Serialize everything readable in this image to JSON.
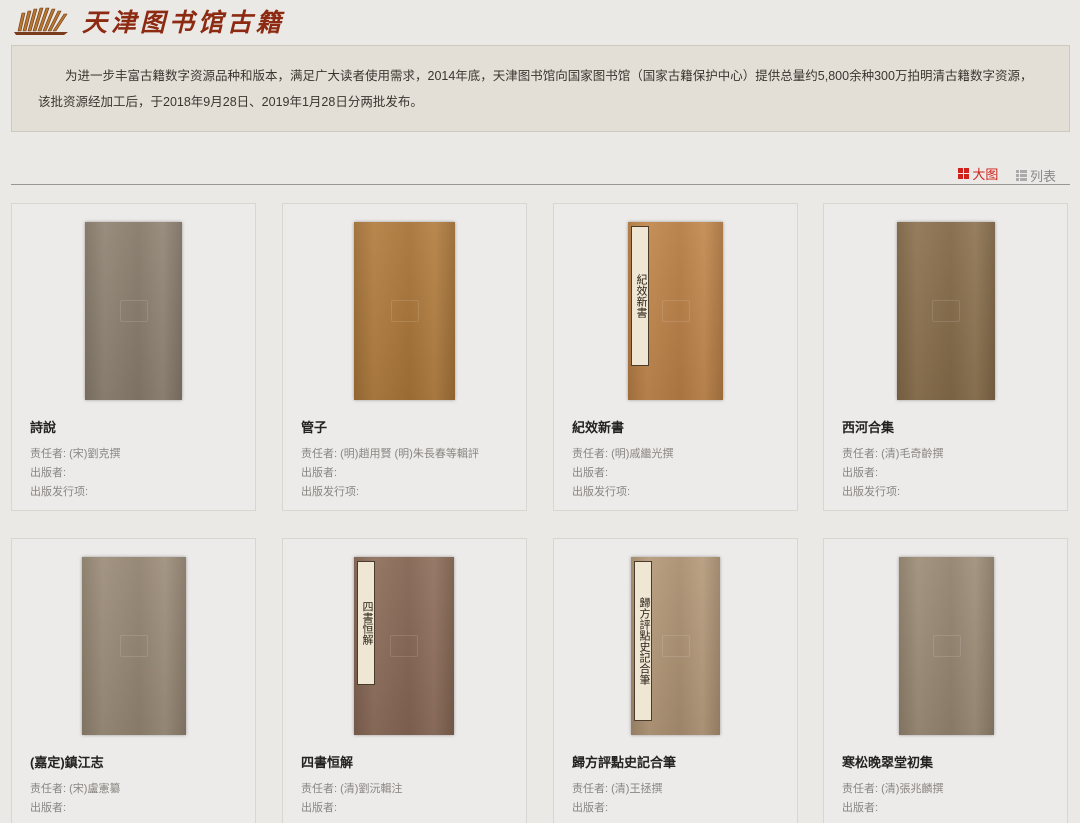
{
  "header": {
    "site_title": "天津图书馆古籍",
    "logo_icon": "bamboo-slips-icon"
  },
  "intro": {
    "text": "为进一步丰富古籍数字资源品种和版本，满足广大读者使用需求，2014年底，天津图书馆向国家图书馆（国家古籍保护中心）提供总量约5,800余种300万拍明清古籍数字资源，该批资源经加工后，于2018年9月28日、2019年1月28日分两批发布。"
  },
  "view_switch": {
    "grid_label": "大图",
    "list_label": "列表",
    "active_color": "#d0211c"
  },
  "books": [
    {
      "title": "詩說",
      "author": "责任者: (宋)劉克撰",
      "publisher": "出版者:",
      "edition": "出版发行项:",
      "cover_color": "#8e8170",
      "cover_label": ""
    },
    {
      "title": "管子",
      "author": "责任者: (明)趙用賢 (明)朱長春等輯評",
      "publisher": "出版者:",
      "edition": "出版发行项:",
      "cover_color": "#b07a3b",
      "cover_label": ""
    },
    {
      "title": "紀效新書",
      "author": "责任者: (明)戚繼光撰",
      "publisher": "出版者:",
      "edition": "出版发行项:",
      "cover_color": "#c08448",
      "cover_label": "紀效新書"
    },
    {
      "title": "西河合集",
      "author": "责任者: (清)毛奇齡撰",
      "publisher": "出版者:",
      "edition": "出版发行项:",
      "cover_color": "#8a6f4c",
      "cover_label": ""
    },
    {
      "title": "(嘉定)鎮江志",
      "author": "责任者: (宋)盧憲纂",
      "publisher": "出版者:",
      "edition": "",
      "cover_color": "#9a8a76",
      "cover_label": ""
    },
    {
      "title": "四書恒解",
      "author": "责任者: (清)劉沅輯注",
      "publisher": "出版者:",
      "edition": "",
      "cover_color": "#8b6a57",
      "cover_label": "四書恒解"
    },
    {
      "title": "歸方評點史記合筆",
      "author": "责任者: (清)王拯撰",
      "publisher": "出版者:",
      "edition": "",
      "cover_color": "#b39777",
      "cover_label": "歸方評點史記合筆"
    },
    {
      "title": "寒松晚翠堂初集",
      "author": "责任者: (清)張兆麟撰",
      "publisher": "出版者:",
      "edition": "",
      "cover_color": "#9b8a74",
      "cover_label": ""
    }
  ]
}
